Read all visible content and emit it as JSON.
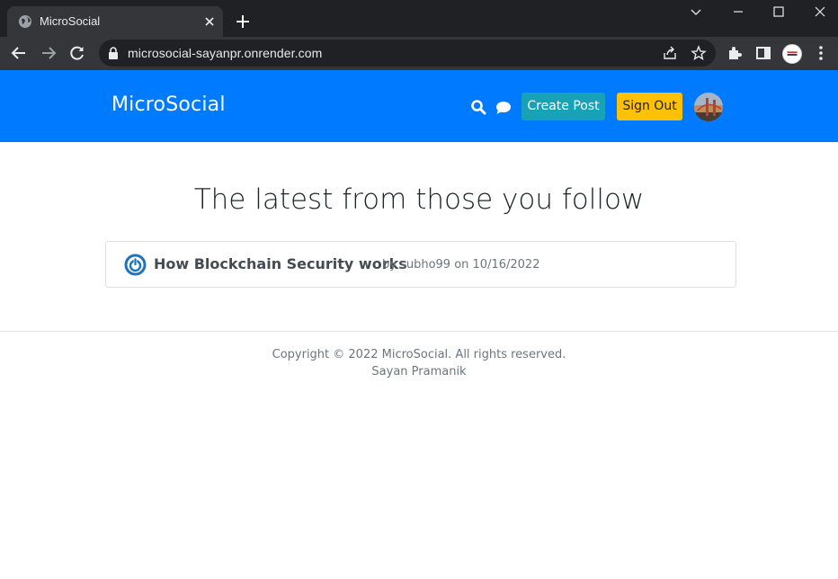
{
  "browser": {
    "tab_title": "MicroSocial",
    "url": "microsocial-sayanpr.onrender.com"
  },
  "navbar": {
    "brand": "MicroSocial",
    "create_post_label": "Create Post",
    "sign_out_label": "Sign Out",
    "colors": {
      "navbar": "#007bff",
      "create_post": "#17a2b8",
      "sign_out": "#ffc107"
    }
  },
  "main": {
    "heading": "The latest from those you follow",
    "posts": [
      {
        "title": "How Blockchain Security works",
        "meta": "by subho99 on 10/16/2022"
      }
    ]
  },
  "footer": {
    "copyright": "Copyright © 2022 MicroSocial. All rights reserved.",
    "author": "Sayan Pramanik"
  }
}
